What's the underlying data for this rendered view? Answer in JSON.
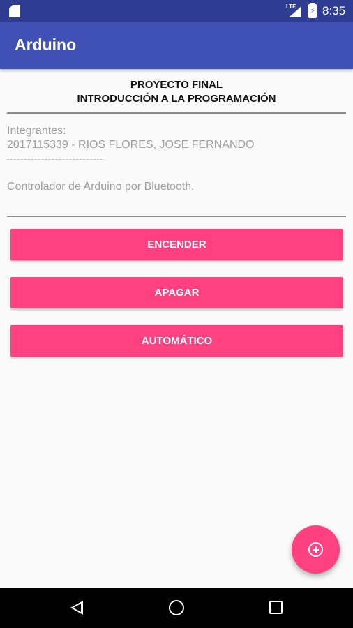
{
  "status_bar": {
    "network": "LTE",
    "time": "8:35"
  },
  "app_bar": {
    "title": "Arduino"
  },
  "header": {
    "line1": "PROYECTO FINAL",
    "line2": "INTRODUCCIÓN A LA PROGRAMACIÓN"
  },
  "info": {
    "members_label": "Integrantes:",
    "member_1": "2017115339 - RIOS FLORES, JOSE FERNANDO",
    "description": "Controlador de Arduino por Bluetooth."
  },
  "buttons": {
    "on": "ENCENDER",
    "off": "APAGAR",
    "auto": "AUTOMÁTICO"
  },
  "colors": {
    "status_bar": "#2f3e93",
    "app_bar": "#3f51b5",
    "accent": "#ff4081"
  }
}
